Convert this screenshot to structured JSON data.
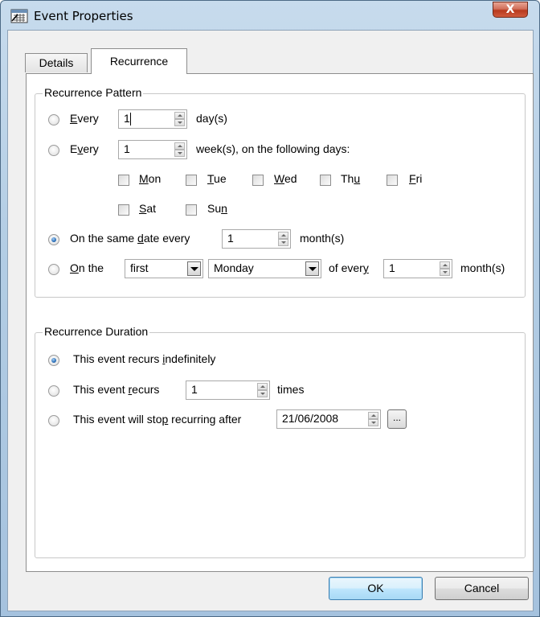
{
  "window": {
    "title": "Event Properties",
    "close_label": "X"
  },
  "tabs": [
    {
      "label": "Details",
      "selected": false
    },
    {
      "label": "Recurrence",
      "selected": true
    }
  ],
  "pattern": {
    "legend": "Recurrence Pattern",
    "daily": {
      "label_pre": "E",
      "label_mn": "very",
      "value": "1",
      "unit": "day(s)",
      "checked": false
    },
    "weekly": {
      "label_pre": "E",
      "label_mn": "v",
      "label_post": "ery",
      "value": "1",
      "unit": "week(s), on the following days:",
      "checked": false
    },
    "days": [
      {
        "pre": "",
        "mn": "M",
        "post": "on"
      },
      {
        "pre": "",
        "mn": "T",
        "post": "ue"
      },
      {
        "pre": "",
        "mn": "W",
        "post": "ed"
      },
      {
        "pre": "Th",
        "mn": "u",
        "post": ""
      },
      {
        "pre": "",
        "mn": "F",
        "post": "ri"
      },
      {
        "pre": "",
        "mn": "S",
        "post": "at"
      },
      {
        "pre": "Su",
        "mn": "n",
        "post": ""
      }
    ],
    "monthly_date": {
      "label_pre": "On the same ",
      "label_mn": "d",
      "label_post": "ate every",
      "value": "1",
      "unit": "month(s)",
      "checked": true
    },
    "monthly_day": {
      "label_pre": "",
      "label_mn": "O",
      "label_post": "n the",
      "ordinal": "first",
      "weekday": "Monday",
      "of_pre": "of ever",
      "of_mn": "y",
      "value": "1",
      "unit": "month(s)",
      "checked": false
    }
  },
  "duration": {
    "legend": "Recurrence Duration",
    "indefinite": {
      "label_pre": "This event recurs ",
      "label_mn": "i",
      "label_post": "ndefinitely",
      "checked": true
    },
    "times": {
      "label_pre": "This event ",
      "label_mn": "r",
      "label_post": "ecurs",
      "value": "1",
      "unit": "times",
      "checked": false
    },
    "until": {
      "label_pre": "This event will sto",
      "label_mn": "p",
      "label_post": " recurring after",
      "date": "21/06/2008",
      "browse_label": "...",
      "checked": false
    }
  },
  "buttons": {
    "ok": "OK",
    "cancel": "Cancel"
  }
}
